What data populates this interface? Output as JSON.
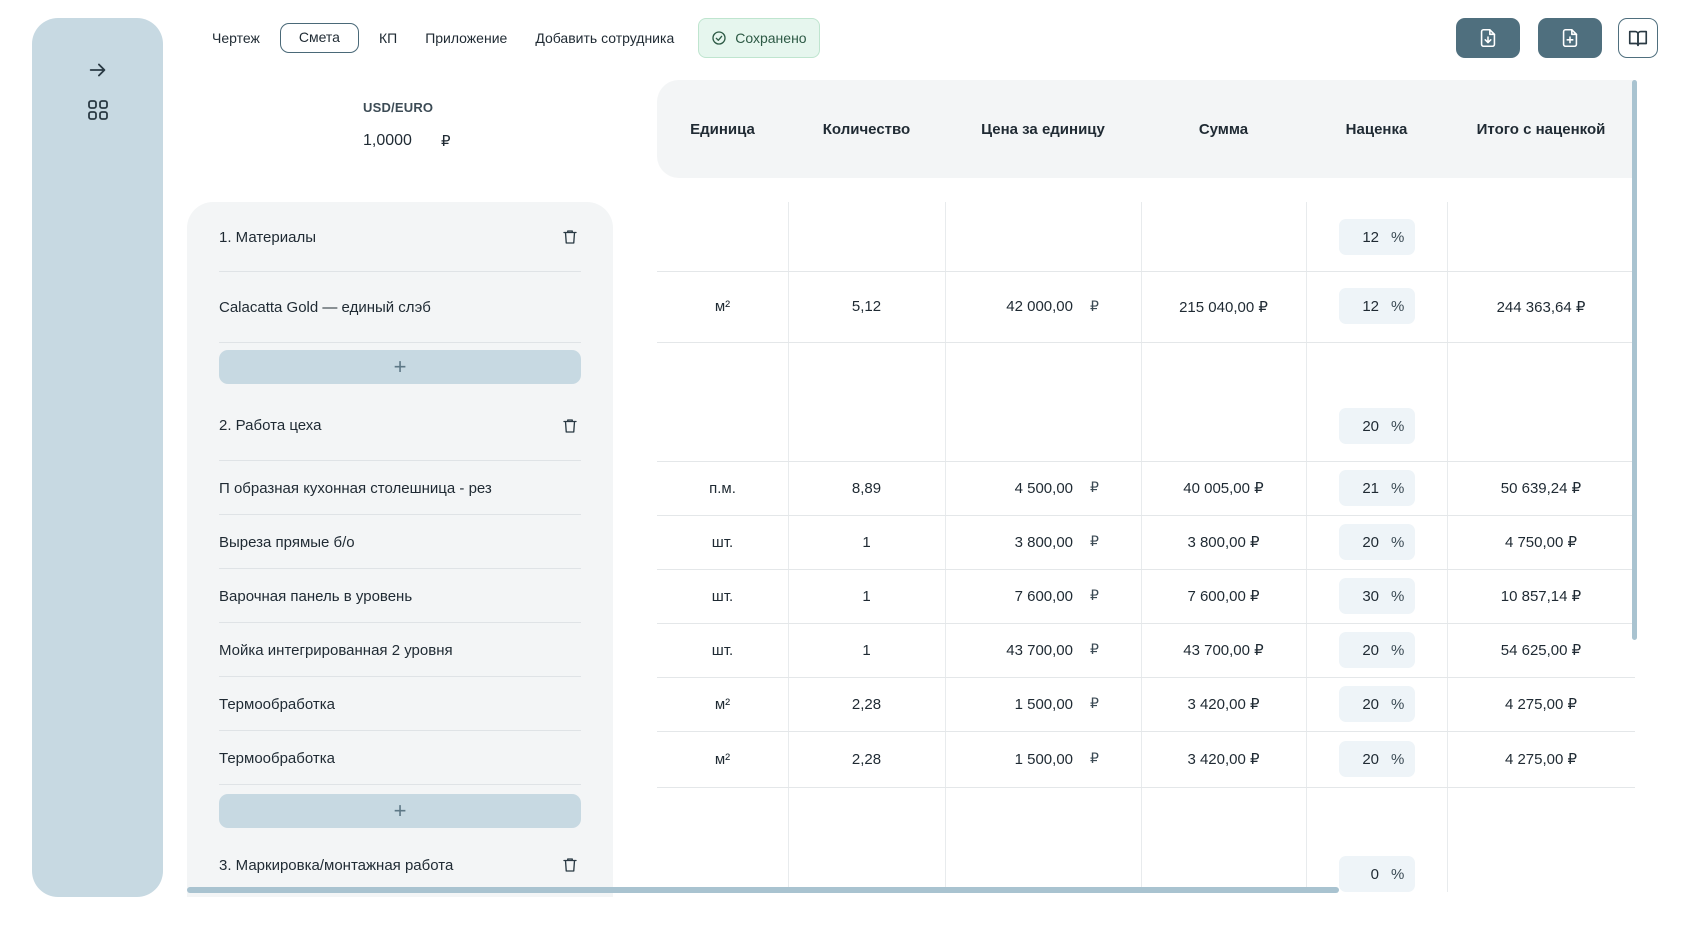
{
  "nav": {
    "tabs": [
      {
        "label": "Чертеж"
      },
      {
        "label": "Смета",
        "active": true
      },
      {
        "label": "КП"
      },
      {
        "label": "Приложение"
      },
      {
        "label": "Добавить сотрудника"
      }
    ],
    "saved_label": "Сохранено"
  },
  "toolbar": {
    "buttons": [
      {
        "icon": "file-download-icon"
      },
      {
        "icon": "file-add-icon"
      },
      {
        "icon": "book-open-icon"
      }
    ]
  },
  "sidebar": {
    "icons": [
      "arrow-right-icon",
      "grid-icon"
    ]
  },
  "currency": {
    "label": "USD/EURO",
    "value": "1,0000",
    "symbol": "₽"
  },
  "table": {
    "headers": [
      "Единица",
      "Количество",
      "Цена за единицу",
      "Сумма",
      "Наценка",
      "Итого с наценкой"
    ],
    "percent_symbol": "%",
    "currency_symbol": "₽"
  },
  "sections": [
    {
      "title": "1. Материалы",
      "markup": "12",
      "items": [
        {
          "name": "Calacatta Gold — единый слэб",
          "unit": "м²",
          "qty": "5,12",
          "price": "42 000,00",
          "sum": "215 040,00 ₽",
          "markup": "12",
          "total": "244 363,64 ₽"
        }
      ]
    },
    {
      "title": "2. Работа цеха",
      "markup": "20",
      "items": [
        {
          "name": "П образная кухонная столешница - рез",
          "unit": "п.м.",
          "qty": "8,89",
          "price": "4 500,00",
          "sum": "40 005,00 ₽",
          "markup": "21",
          "total": "50 639,24 ₽"
        },
        {
          "name": "Выреза прямые б/о",
          "unit": "шт.",
          "qty": "1",
          "price": "3 800,00",
          "sum": "3 800,00 ₽",
          "markup": "20",
          "total": "4 750,00 ₽"
        },
        {
          "name": "Варочная панель в уровень",
          "unit": "шт.",
          "qty": "1",
          "price": "7 600,00",
          "sum": "7 600,00 ₽",
          "markup": "30",
          "total": "10 857,14 ₽"
        },
        {
          "name": "Мойка интегрированная 2 уровня",
          "unit": "шт.",
          "qty": "1",
          "price": "43 700,00",
          "sum": "43 700,00 ₽",
          "markup": "20",
          "total": "54 625,00 ₽"
        },
        {
          "name": "Термообработка",
          "unit": "м²",
          "qty": "2,28",
          "price": "1 500,00",
          "sum": "3 420,00 ₽",
          "markup": "20",
          "total": "4 275,00 ₽"
        },
        {
          "name": "Термообработка",
          "unit": "м²",
          "qty": "2,28",
          "price": "1 500,00",
          "sum": "3 420,00 ₽",
          "markup": "20",
          "total": "4 275,00 ₽"
        }
      ]
    },
    {
      "title": "3. Маркировка/монтажная работа",
      "markup": "0",
      "items": []
    }
  ],
  "add_label": "+",
  "colors": {
    "sidebar": "#c7d9e2",
    "accent": "#4f6f7e",
    "saved_bg": "#e6f6ee",
    "panel": "#f3f5f6"
  }
}
